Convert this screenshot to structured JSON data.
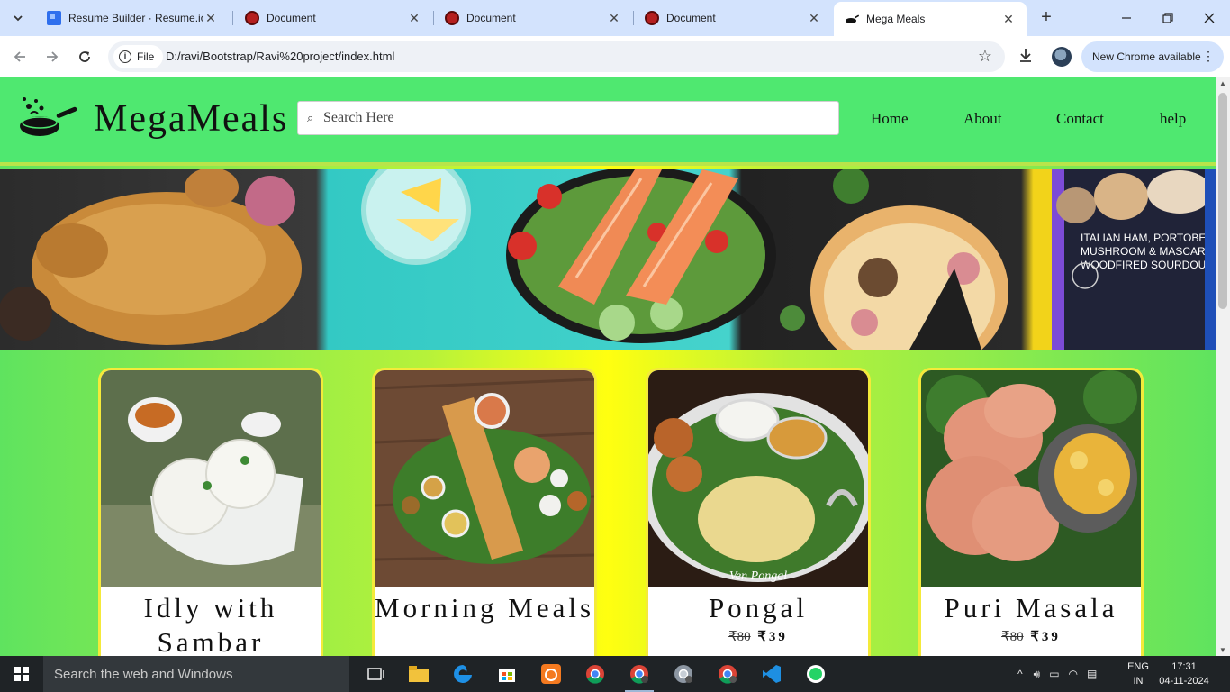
{
  "browser": {
    "tabs": [
      {
        "title": "Resume Builder · Resume.io",
        "favicon": "resume-io-icon"
      },
      {
        "title": "Document",
        "favicon": "document-icon"
      },
      {
        "title": "Document",
        "favicon": "document-icon"
      },
      {
        "title": "Document",
        "favicon": "document-icon"
      },
      {
        "title": "Mega Meals",
        "favicon": "pan-icon",
        "active": true
      }
    ],
    "new_tab": "+",
    "address": {
      "scheme_label": "File",
      "url": "D:/ravi/Bootstrap/Ravi%20project/index.html"
    },
    "update_label": "New Chrome available"
  },
  "site": {
    "brand": "MegaMeals",
    "search_placeholder": "Search Here",
    "nav": [
      "Home",
      "About",
      "Contact",
      "help"
    ],
    "cards": [
      {
        "name": "Idly with Sambar",
        "old_price": "",
        "price": ""
      },
      {
        "name": "Morning Meals",
        "old_price": "",
        "price": ""
      },
      {
        "name": "Pongal",
        "old_price": "₹80",
        "price": "₹39",
        "photo_caption": "Ven Pongal"
      },
      {
        "name": "Puri Masala",
        "old_price": "₹80",
        "price": "₹39"
      }
    ],
    "banner_box_text": [
      "ITALIAN HAM, PORTOBELL",
      "MUSHROOM & MASCARPO",
      "WOODFIRED SOURDOUGH PI"
    ]
  },
  "taskbar": {
    "search_placeholder": "Search the web and Windows",
    "lang_line1": "ENG",
    "lang_line2": "IN",
    "time": "17:31",
    "date": "04-11-2024"
  },
  "colors": {
    "header_green": "#4fe870",
    "card_border": "#f4ea3a",
    "tab_strip": "#d3e3fd"
  }
}
